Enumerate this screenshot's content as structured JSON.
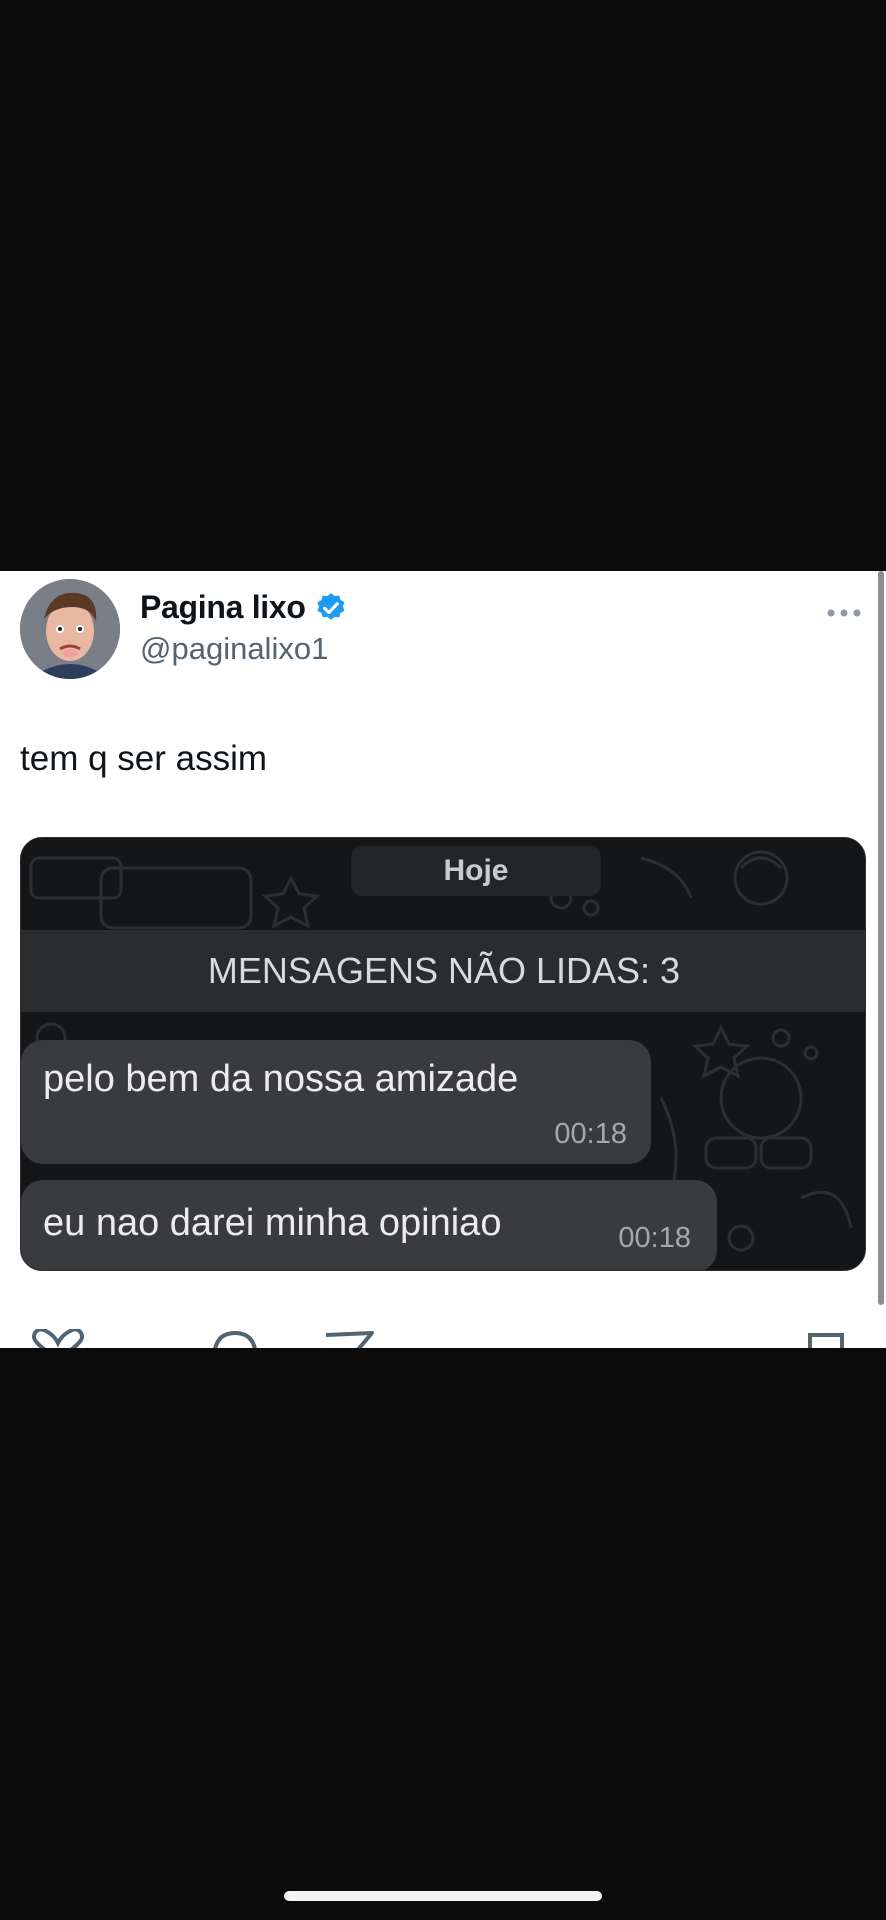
{
  "tweet": {
    "display_name": "Pagina lixo",
    "handle": "@paginalixo1",
    "text": "tem q ser assim",
    "verified_color": "#1d9bf0"
  },
  "media": {
    "date_label": "Hoje",
    "unread_label": "MENSAGENS NÃO LIDAS: 3",
    "messages": [
      {
        "text": "pelo bem da nossa amizade",
        "time": "00:18"
      },
      {
        "text": "eu nao darei minha opiniao",
        "time": "00:18"
      }
    ]
  },
  "icons": {
    "verified": "verified-badge-icon",
    "more": "more-horizontal-icon",
    "like": "heart-icon",
    "reply": "reply-bubble-icon",
    "share": "share-icon",
    "bookmark": "bookmark-icon"
  },
  "colors": {
    "background": "#0b0b0c",
    "card": "#ffffff",
    "chat_bg": "#151617",
    "bubble": "#393b3e"
  }
}
